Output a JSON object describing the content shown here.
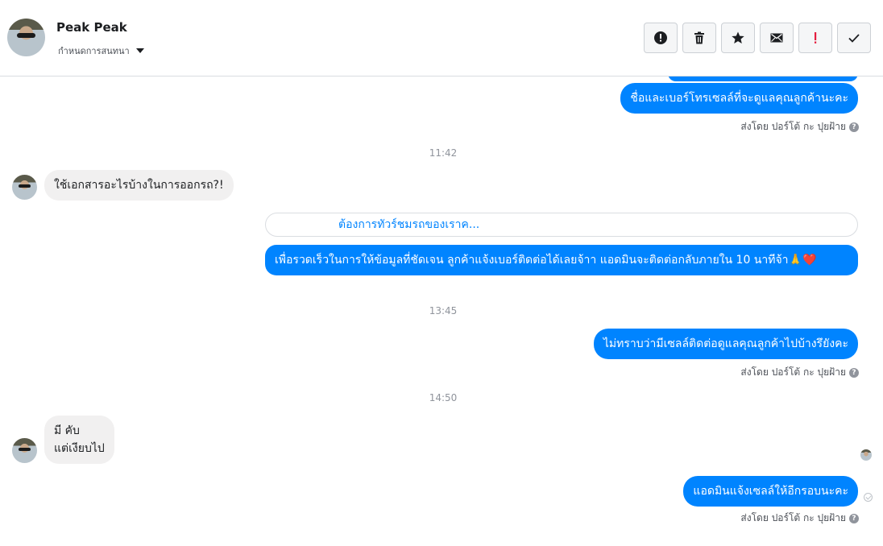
{
  "header": {
    "contact_name": "Peak Peak",
    "assign_label": "กำหนดการสนทนา",
    "actions": [
      {
        "name": "report-spam-button",
        "icon": "alert-circle-icon"
      },
      {
        "name": "delete-button",
        "icon": "trash-icon"
      },
      {
        "name": "star-button",
        "icon": "star-icon"
      },
      {
        "name": "mark-unread-button",
        "icon": "envelope-icon"
      },
      {
        "name": "mark-important-button",
        "icon": "exclamation-icon"
      },
      {
        "name": "mark-done-button",
        "icon": "check-icon"
      }
    ]
  },
  "thread": {
    "messages": [
      {
        "dir": "out",
        "text": "ชื่อและเบอร์โทรเซลล์ที่จะดูแลคุณลูกค้านะคะ",
        "sent_by": "ส่งโดย ปอร์โต้ กะ ปุยฝ้าย"
      },
      {
        "dir": "time",
        "text": "11:42"
      },
      {
        "dir": "in",
        "text": "ใช้เอกสารอะไรบ้างในการออกรถ?!"
      },
      {
        "dir": "quick_reply",
        "text": "ต้องการทัวร์ชมรถของเราค..."
      },
      {
        "dir": "out",
        "text": "เพื่อรวดเร็วในการให้ข้อมูลที่ชัดเจน ลูกค้าแจ้งเบอร์ติดต่อได้เลยจ้าา แอดมินจะติดต่อกลับภายใน 10 นาทีจ้า🙏❤️"
      },
      {
        "dir": "time",
        "text": "13:45"
      },
      {
        "dir": "out",
        "text": "ไม่ทราบว่ามีเซลล์ติดต่อดูแลคุณลูกค้าไปบ้างรึยังคะ",
        "sent_by": "ส่งโดย ปอร์โต้ กะ ปุยฝ้าย"
      },
      {
        "dir": "time",
        "text": "14:50"
      },
      {
        "dir": "in",
        "text_lines": [
          "มี คับ",
          "แต่เงียบไป"
        ]
      },
      {
        "dir": "out",
        "text": "แอดมินแจ้งเซลล์ให้อีกรอบนะคะ",
        "sent_by": "ส่งโดย ปอร์โต้ กะ ปุยฝ้าย"
      }
    ],
    "help_glyph": "?"
  },
  "colors": {
    "outgoing": "#0084ff",
    "incoming": "#f1f0f0",
    "important": "#e41e3f"
  }
}
